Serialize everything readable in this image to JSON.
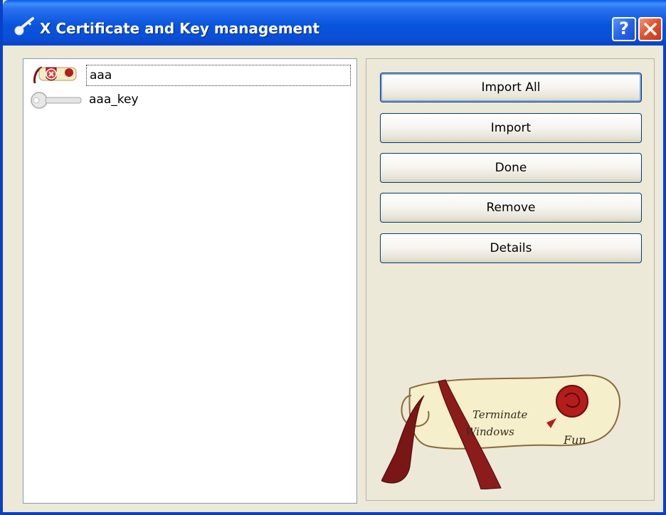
{
  "window": {
    "title": "X Certificate and Key management",
    "help_symbol": "?",
    "close_symbol": "✕"
  },
  "list": {
    "items": [
      {
        "label": "aaa",
        "icon": "certificate-error-icon",
        "selected": true
      },
      {
        "label": "aaa_key",
        "icon": "key-icon",
        "selected": false
      }
    ]
  },
  "buttons": {
    "import_all": "Import All",
    "import": "Import",
    "done": "Done",
    "remove": "Remove",
    "details": "Details"
  },
  "logo": {
    "line1": "Terminate",
    "line2": "Windows",
    "line3": "Fun"
  },
  "colors": {
    "titlebar": "#0a4fd8",
    "window_bg": "#ece9d8",
    "close_btn": "#e2542b",
    "ribbon": "#7a1616",
    "scroll": "#f3ecc4"
  }
}
